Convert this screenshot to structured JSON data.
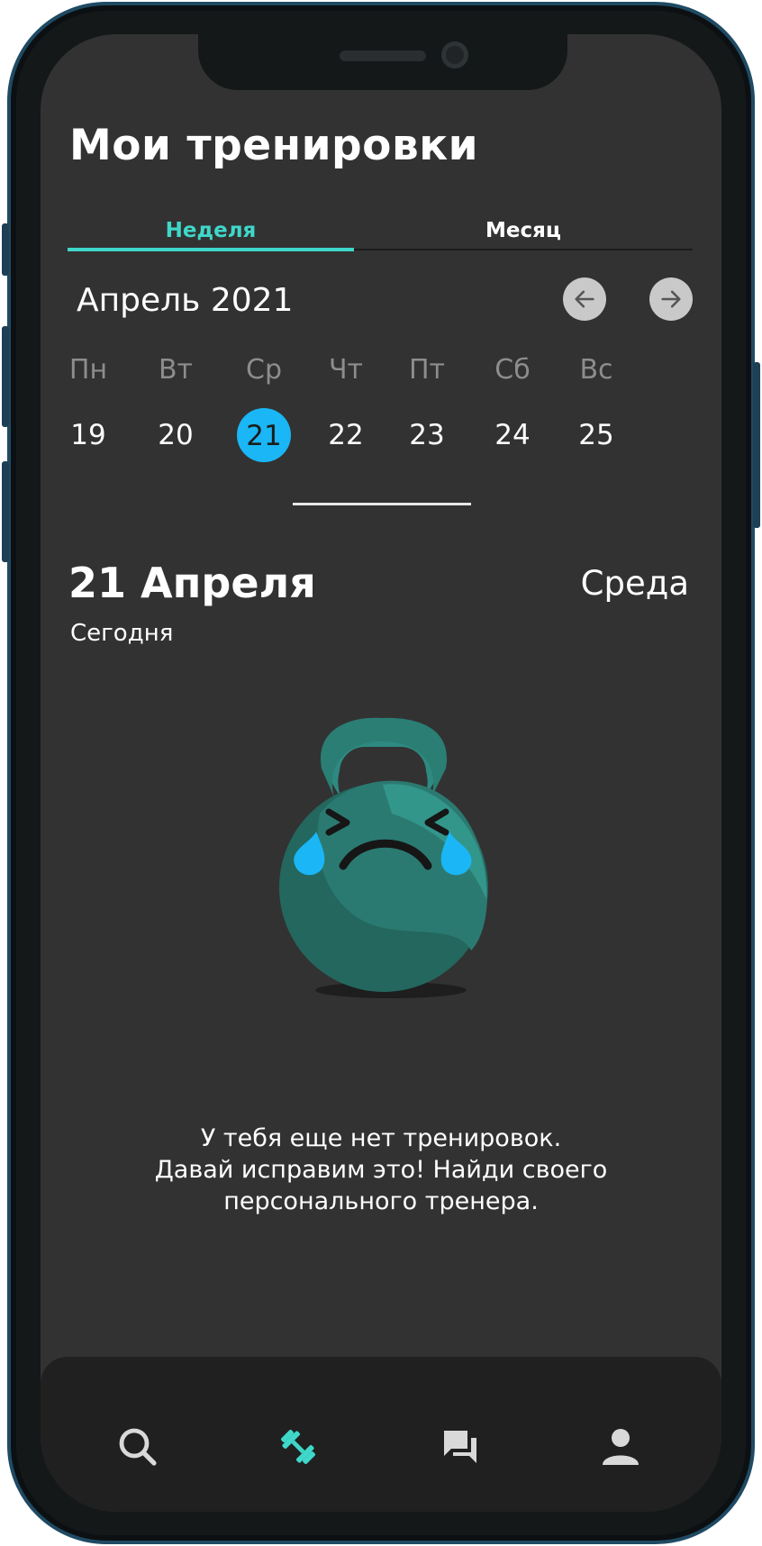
{
  "header": {
    "title": "Мои тренировки"
  },
  "tabs": [
    {
      "label": "Неделя",
      "active": true
    },
    {
      "label": "Месяц",
      "active": false
    }
  ],
  "calendar": {
    "month_label": "Апрель 2021",
    "weekdays": [
      "Пн",
      "Вт",
      "Ср",
      "Чт",
      "Пт",
      "Сб",
      "Вс"
    ],
    "days": [
      "19",
      "20",
      "21",
      "22",
      "23",
      "24",
      "25"
    ],
    "selected_day": "21",
    "prev_icon": "arrow-left-icon",
    "next_icon": "arrow-right-icon"
  },
  "selected_date": {
    "title": "21 Апреля",
    "subtitle": "Сегодня",
    "weekday": "Среда"
  },
  "empty_state": {
    "illustration": "crying-kettlebell",
    "lines": [
      "У тебя еще нет тренировок.",
      "Давай исправим это! Найди своего",
      "персонального тренера."
    ]
  },
  "bottom_nav": {
    "items": [
      {
        "icon": "search-icon",
        "active": false
      },
      {
        "icon": "dumbbell-icon",
        "active": true
      },
      {
        "icon": "chat-icon",
        "active": false
      },
      {
        "icon": "profile-icon",
        "active": false
      }
    ]
  },
  "colors": {
    "accent": "#3fd7c9",
    "selected_day": "#1ab6f5",
    "background": "#323232",
    "nav_background": "#202020"
  }
}
